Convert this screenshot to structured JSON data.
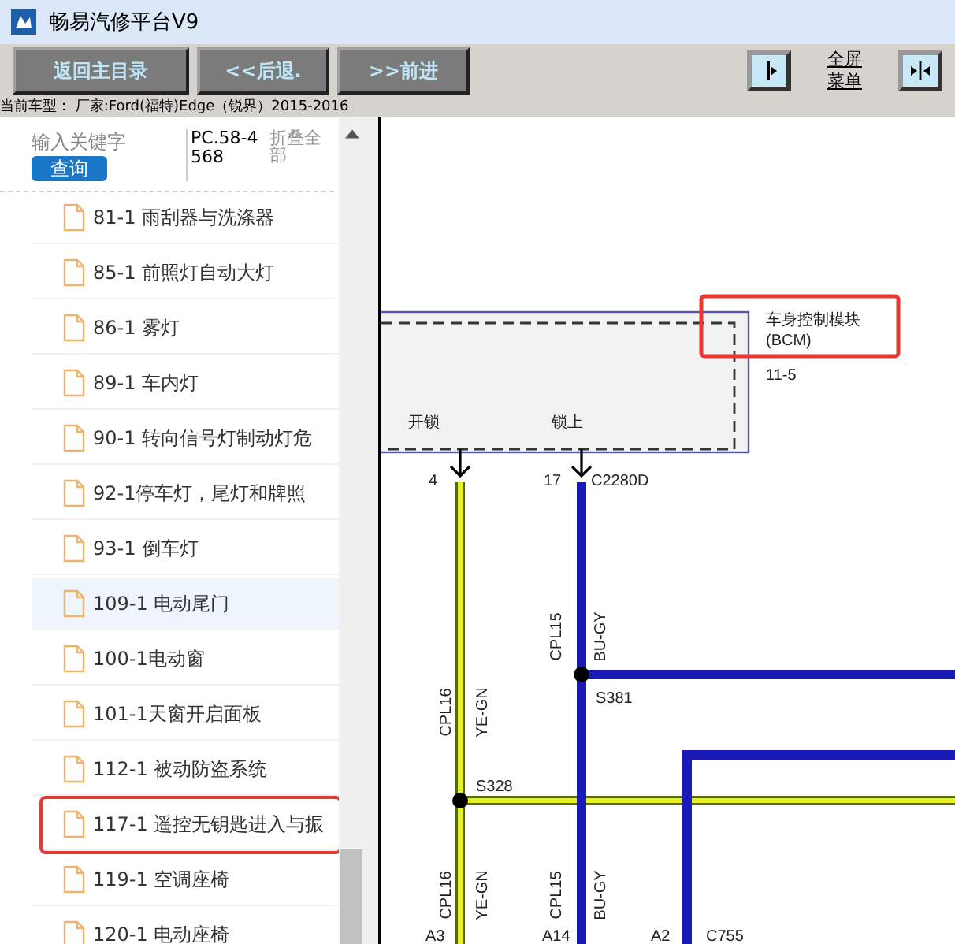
{
  "window": {
    "title": "畅易汽修平台V9"
  },
  "toolbar": {
    "buttons": [
      "返回主目录",
      "<<后退.",
      ">>前进"
    ],
    "fullscreen_menu": [
      "全屏",
      "菜单"
    ]
  },
  "vehicle_line": "当前车型： 厂家:Ford(福特)Edge（锐界）2015-2016",
  "search": {
    "placeholder": "输入关键字",
    "button": "查询",
    "code": "PC.58-4568",
    "collapse": "折叠全部"
  },
  "items": [
    {
      "label": "81-1 雨刮器与洗涤器",
      "selected": false,
      "highlighted": false
    },
    {
      "label": "85-1 前照灯自动大灯",
      "selected": false,
      "highlighted": false
    },
    {
      "label": "86-1 雾灯",
      "selected": false,
      "highlighted": false
    },
    {
      "label": "89-1 车内灯",
      "selected": false,
      "highlighted": false
    },
    {
      "label": "90-1 转向信号灯制动灯危",
      "selected": false,
      "highlighted": false
    },
    {
      "label": "92-1停车灯，尾灯和牌照",
      "selected": false,
      "highlighted": false
    },
    {
      "label": "93-1 倒车灯",
      "selected": false,
      "highlighted": false
    },
    {
      "label": "109-1 电动尾门",
      "selected": true,
      "highlighted": false
    },
    {
      "label": "100-1电动窗",
      "selected": false,
      "highlighted": false
    },
    {
      "label": "101-1天窗开启面板",
      "selected": false,
      "highlighted": false
    },
    {
      "label": "112-1 被动防盗系统",
      "selected": false,
      "highlighted": false
    },
    {
      "label": "117-1 遥控无钥匙进入与振",
      "selected": false,
      "highlighted": true
    },
    {
      "label": "119-1 空调座椅",
      "selected": false,
      "highlighted": false
    },
    {
      "label": "120-1 电动座椅",
      "selected": false,
      "highlighted": false
    }
  ],
  "diagram": {
    "module": {
      "name": "车身控制模块",
      "abbr": "(BCM)",
      "ref": "11-5",
      "highlighted": true
    },
    "labels": [
      "开锁",
      "锁上",
      "4",
      "17",
      "C2280D",
      "CPL15",
      "BU-GY",
      "CPL16",
      "YE-GN",
      "S381",
      "S328",
      "CPL16",
      "YE-GN",
      "CPL15",
      "BU-GY",
      "A3",
      "A14",
      "A2",
      "C755"
    ]
  }
}
